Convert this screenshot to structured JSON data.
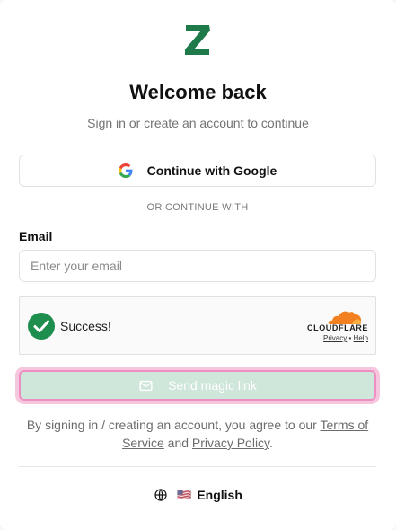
{
  "header": {
    "logo_letter": "Z",
    "title": "Welcome back",
    "subtitle": "Sign in or create an account to continue"
  },
  "google": {
    "label": "Continue with Google",
    "icon": "google-icon"
  },
  "divider": {
    "text": "OR CONTINUE WITH"
  },
  "email": {
    "label": "Email",
    "placeholder": "Enter your email",
    "value": ""
  },
  "captcha": {
    "status": "Success!",
    "brand": "CLOUDFLARE",
    "privacy": "Privacy",
    "separator": "•",
    "help": "Help"
  },
  "send": {
    "label": "Send magic link",
    "icon": "mail-icon"
  },
  "terms": {
    "prefix": "By signing in / creating an account, you agree to our ",
    "tos": "Terms of Service",
    "and": " and ",
    "privacy": "Privacy Policy",
    "suffix": "."
  },
  "language": {
    "flag": "🇺🇸",
    "label": "English",
    "icon": "globe-icon"
  },
  "colors": {
    "brand_green": "#1f7a4a",
    "success_green": "#1e8e4e",
    "send_bg": "#cfe6da",
    "focus_ring": "#ee8fc2"
  }
}
